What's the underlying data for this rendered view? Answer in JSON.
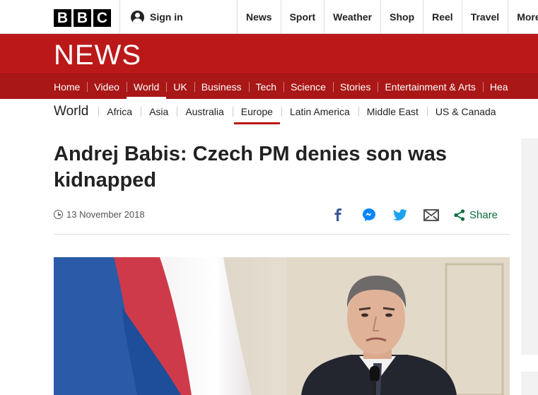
{
  "masthead": {
    "logo_letters": [
      "B",
      "B",
      "C"
    ],
    "signin_label": "Sign in",
    "nav": [
      "News",
      "Sport",
      "Weather",
      "Shop",
      "Reel",
      "Travel",
      "More"
    ]
  },
  "banner": {
    "title": "NEWS",
    "nav": [
      "Home",
      "Video",
      "World",
      "UK",
      "Business",
      "Tech",
      "Science",
      "Stories",
      "Entertainment & Arts",
      "Hea"
    ],
    "active": "World"
  },
  "world_nav": {
    "section": "World",
    "items": [
      "Africa",
      "Asia",
      "Australia",
      "Europe",
      "Latin America",
      "Middle East",
      "US & Canada"
    ],
    "active": "Europe"
  },
  "article": {
    "headline": "Andrej Babis: Czech PM denies son was kidnapped",
    "date": "13 November 2018",
    "share_label": "Share",
    "share_icons": [
      "facebook-icon",
      "messenger-icon",
      "twitter-icon",
      "email-icon",
      "share-icon"
    ]
  },
  "colors": {
    "brand_red": "#bb1919",
    "nav_red": "#a91717",
    "share_green": "#076c3e",
    "facebook_blue": "#3b5998",
    "messenger_blue": "#0084ff",
    "twitter_blue": "#1da1f2"
  }
}
